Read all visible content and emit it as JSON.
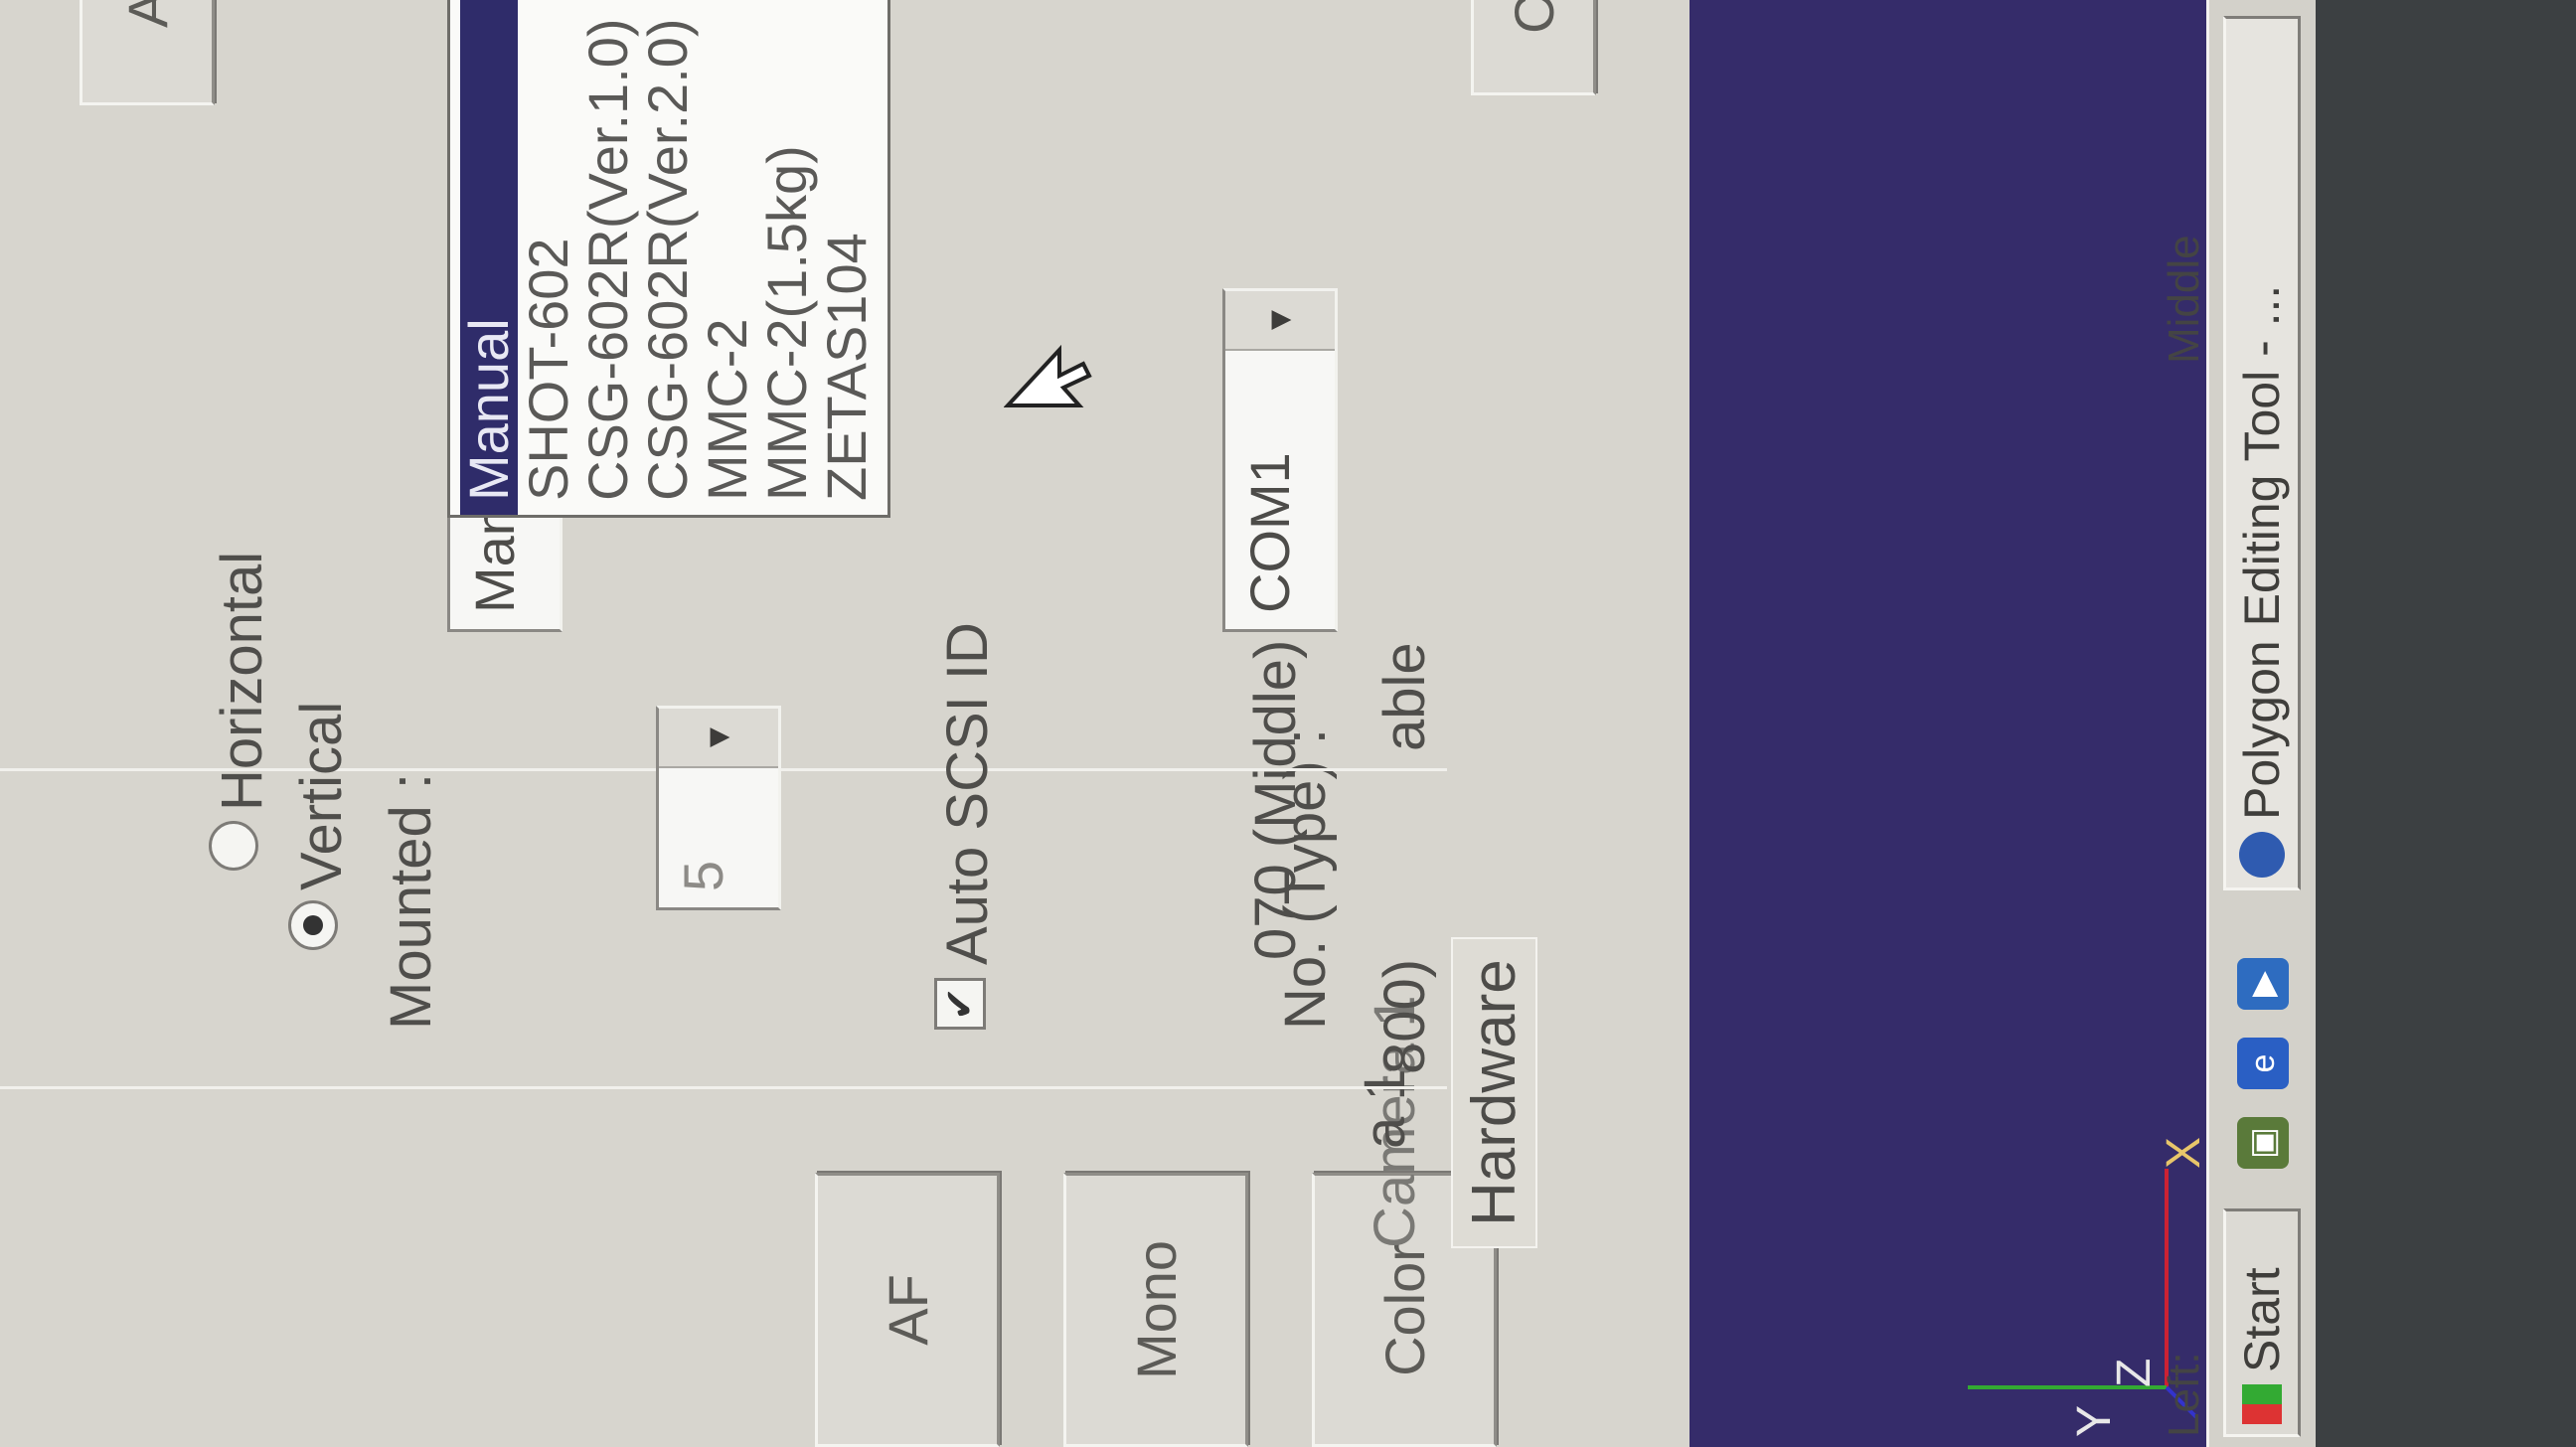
{
  "tabs": [
    "Camera 1",
    "Hardware"
  ],
  "left_fragments": {
    "line1": "a 1",
    "line2": "800)",
    "line3": "No. (Type) :",
    "line4": "070 (Middle)",
    "line5": "able"
  },
  "mode_buttons": [
    "AF",
    "Mono",
    "Color"
  ],
  "auto_scsi": {
    "label": "Auto SCSI ID",
    "checked": true,
    "id_value": "5"
  },
  "mounted": {
    "label": "Mounted :",
    "options": [
      "Vertical",
      "Horizontal"
    ],
    "selected": "Vertical"
  },
  "port_combo": {
    "value": "COM1"
  },
  "stage_combo": {
    "value": "Manual"
  },
  "stage_list": {
    "items": [
      "Manual",
      "SHOT-602",
      "CSG-602R(Ver.1.0)",
      "CSG-602R(Ver.2.0)",
      "MMC-2",
      "MMC-2(1.5kg)",
      "ZETAS104"
    ],
    "selected": "Manual"
  },
  "apply_button": "Apply",
  "close_button": "Clos",
  "axes": {
    "x": "X",
    "z": "Z",
    "y": "Y"
  },
  "status_left": "Middle",
  "status_lft": "Left:",
  "taskbar": {
    "start": "Start",
    "task": "Polygon Editing Tool - ..."
  }
}
